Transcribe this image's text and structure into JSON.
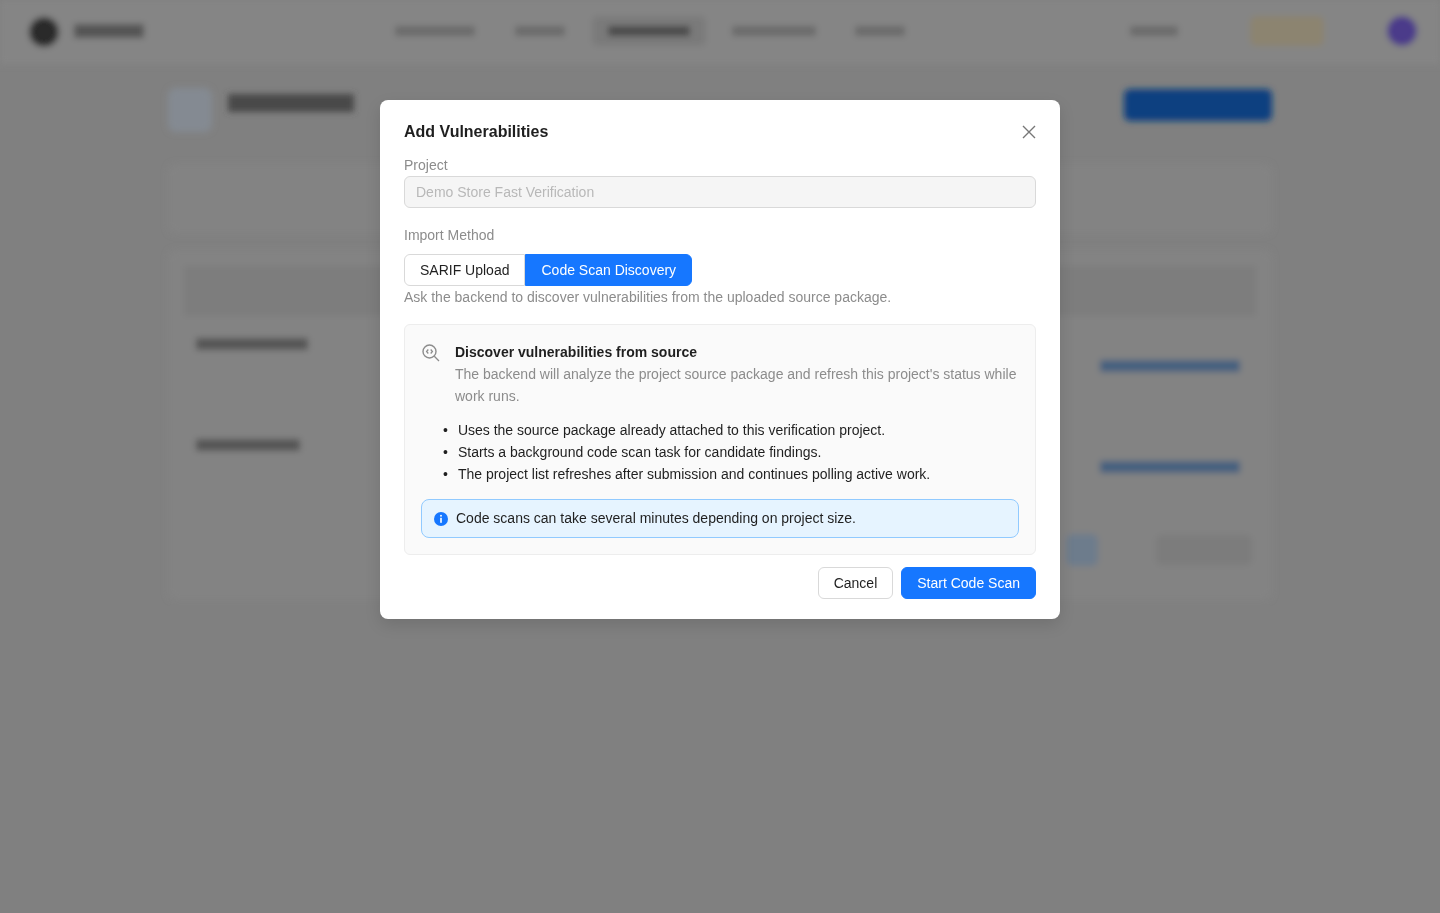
{
  "dialog": {
    "title": "Add Vulnerabilities",
    "project": {
      "label": "Project",
      "value": "Demo Store Fast Verification",
      "disabled": true
    },
    "import_method": {
      "label": "Import Method",
      "options": [
        {
          "label": "SARIF Upload",
          "selected": false
        },
        {
          "label": "Code Scan Discovery",
          "selected": true
        }
      ],
      "help": "Ask the backend to discover vulnerabilities from the uploaded source package."
    },
    "info_panel": {
      "title": "Discover vulnerabilities from source",
      "description": "The backend will analyze the project source package and refresh this project's status while work runs.",
      "bullets": [
        {
          "marker": "•",
          "text": "Uses the source package already attached to this verification project."
        },
        {
          "marker": "•",
          "text": "Starts a background code scan task for candidate findings."
        },
        {
          "marker": "•",
          "text": "The project list refreshes after submission and continues polling active work."
        }
      ],
      "alert": "Code scans can take several minutes depending on project size."
    },
    "buttons": [
      {
        "label": "Cancel",
        "kind": "default"
      },
      {
        "label": "Start Code Scan",
        "kind": "primary"
      }
    ]
  }
}
